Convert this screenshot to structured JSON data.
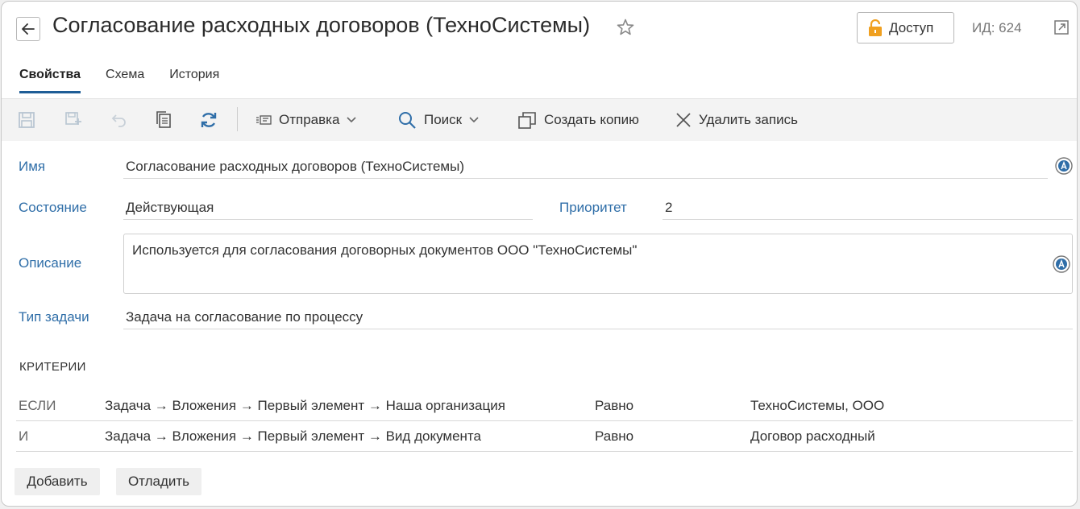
{
  "header": {
    "title": "Согласование расходных договоров (ТехноСистемы)",
    "access_label": "Доступ",
    "id_label": "ИД: 624"
  },
  "tabs": [
    {
      "label": "Свойства",
      "active": true
    },
    {
      "label": "Схема",
      "active": false
    },
    {
      "label": "История",
      "active": false
    }
  ],
  "toolbar": {
    "send_label": "Отправка",
    "search_label": "Поиск",
    "copy_label": "Создать копию",
    "delete_label": "Удалить запись",
    "icons": [
      "save-icon",
      "save-and-close-icon",
      "undo-icon",
      "copy-document-icon",
      "refresh-icon",
      "send-icon",
      "search-icon",
      "create-copy-icon",
      "close-icon"
    ]
  },
  "form": {
    "name_label": "Имя",
    "name_value": "Согласование расходных договоров (ТехноСистемы)",
    "state_label": "Состояние",
    "state_value": "Действующая",
    "priority_label": "Приоритет",
    "priority_value": "2",
    "description_label": "Описание",
    "description_value": "Используется для согласования договорных документов ООО \"ТехноСистемы\"",
    "task_type_label": "Тип задачи",
    "task_type_value": "Задача на согласование по процессу"
  },
  "criteria": {
    "title": "КРИТЕРИИ",
    "rows": [
      {
        "operator": "ЕСЛИ",
        "field": "Задача → Вложения → Первый элемент → Наша организация",
        "condition": "Равно",
        "value": "ТехноСистемы, ООО"
      },
      {
        "operator": "И",
        "field": "Задача → Вложения → Первый элемент → Вид документа",
        "condition": "Равно",
        "value": "Договор расходный"
      }
    ]
  },
  "buttons": {
    "add_label": "Добавить",
    "debug_label": "Отладить"
  },
  "colors": {
    "accent": "#1e5d96",
    "label": "#2f6ea8",
    "lock": "#f0a020"
  }
}
